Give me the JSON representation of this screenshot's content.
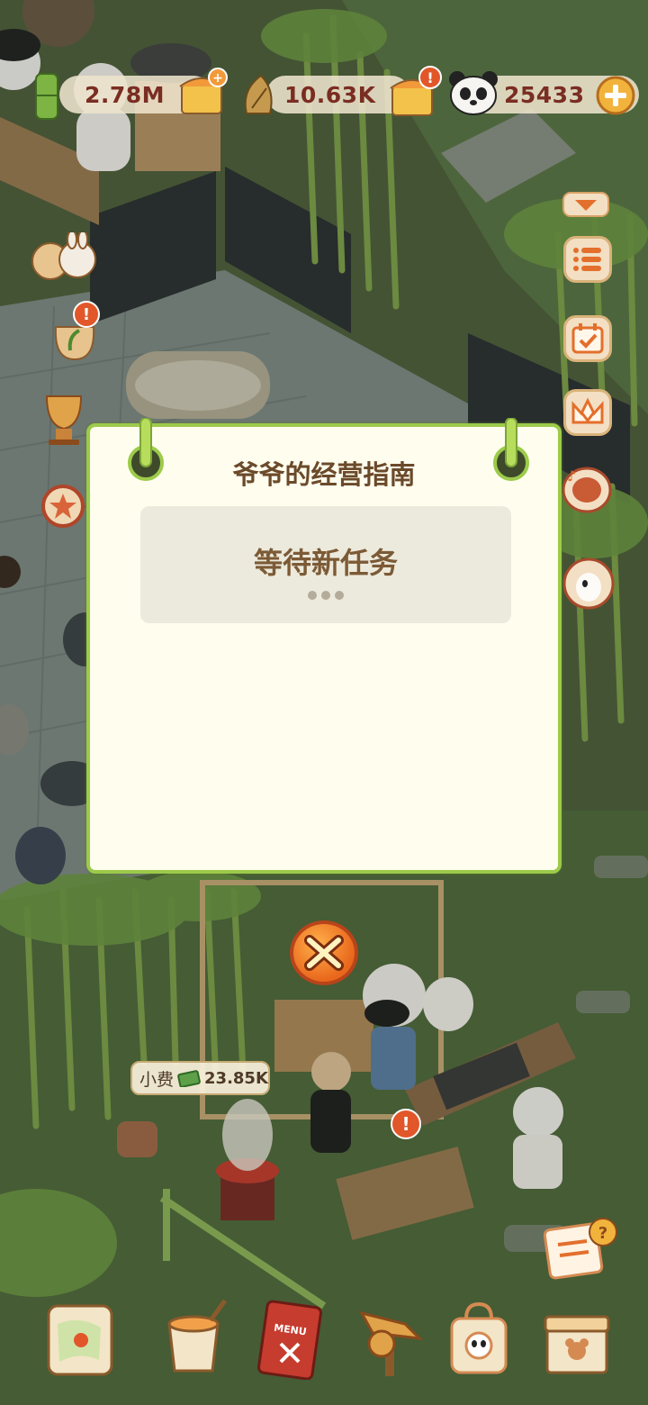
{
  "resources": {
    "bamboo": "2.78M",
    "bamboo_shoot": "10.63K",
    "panda_coin": "25433"
  },
  "guide_dialog": {
    "title": "爷爷的经营指南",
    "task_status": "等待新任务"
  },
  "tip_bubble": {
    "label": "小费",
    "amount": "23.85K"
  },
  "side_menu": [
    "expand-arrow-icon",
    "task-list-icon",
    "calendar-check-icon",
    "crown-icon",
    "music-drum-icon",
    "character-icon"
  ],
  "bottom_bar": [
    "map-icon",
    "paint-bucket-icon",
    "menu-book-icon",
    "wood-sign-icon",
    "shop-bag-icon",
    "box-icon"
  ],
  "bottom_bar_text": {
    "menu_book_label": "MENU"
  },
  "colors": {
    "dialog_border": "#9ccb4a",
    "dialog_bg": "#fefdee",
    "close_button": "#e9671c",
    "resource_text": "#7a2d22"
  }
}
